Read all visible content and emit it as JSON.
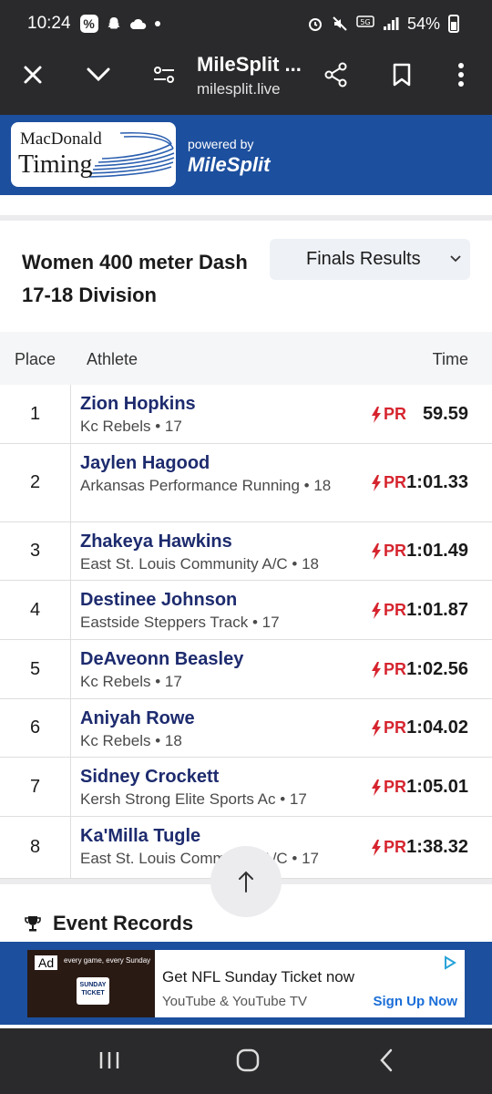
{
  "status": {
    "time": "10:24",
    "battery": "54%"
  },
  "browser": {
    "title": "MileSplit ...",
    "url": "milesplit.live"
  },
  "banner": {
    "logo_line1": "MacDonald",
    "logo_line2": "Timing",
    "powered_by": "powered by",
    "brand": "MileSplit"
  },
  "event": {
    "title": "Women 400 meter Dash 17-18 Division",
    "results_select": "Finals Results"
  },
  "table": {
    "headers": {
      "place": "Place",
      "athlete": "Athlete",
      "time": "Time"
    },
    "rows": [
      {
        "place": "1",
        "name": "Zion Hopkins",
        "team": "Kc Rebels • 17",
        "pr": "PR",
        "time": "59.59"
      },
      {
        "place": "2",
        "name": "Jaylen Hagood",
        "team": "Arkansas Performance Running • 18",
        "pr": "PR",
        "time": "1:01.33"
      },
      {
        "place": "3",
        "name": "Zhakeya Hawkins",
        "team": "East St. Louis Community A/C • 18",
        "pr": "PR",
        "time": "1:01.49"
      },
      {
        "place": "4",
        "name": "Destinee Johnson",
        "team": "Eastside Steppers Track • 17",
        "pr": "PR",
        "time": "1:01.87"
      },
      {
        "place": "5",
        "name": "DeAveonn Beasley",
        "team": "Kc Rebels • 17",
        "pr": "PR",
        "time": "1:02.56"
      },
      {
        "place": "6",
        "name": "Aniyah Rowe",
        "team": "Kc Rebels • 18",
        "pr": "PR",
        "time": "1:04.02"
      },
      {
        "place": "7",
        "name": "Sidney Crockett",
        "team": "Kersh Strong Elite Sports Ac • 17",
        "pr": "PR",
        "time": "1:05.01"
      },
      {
        "place": "8",
        "name": "Ka'Milla Tugle",
        "team": "East St. Louis Community A/C • 17",
        "pr": "PR",
        "time": "1:38.32"
      }
    ]
  },
  "records": {
    "title": "Event Records"
  },
  "ad": {
    "tag": "Ad",
    "image_caption": "every game, every Sunday",
    "image_badge_1": "SUNDAY",
    "image_badge_2": "TICKET",
    "title": "Get NFL Sunday Ticket now",
    "subtitle": "YouTube & YouTube TV",
    "cta": "Sign Up Now"
  },
  "colors": {
    "banner": "#1c4f9e",
    "name": "#1d2b6e",
    "pr": "#d6252f",
    "topbar": "#2a2a2c"
  }
}
